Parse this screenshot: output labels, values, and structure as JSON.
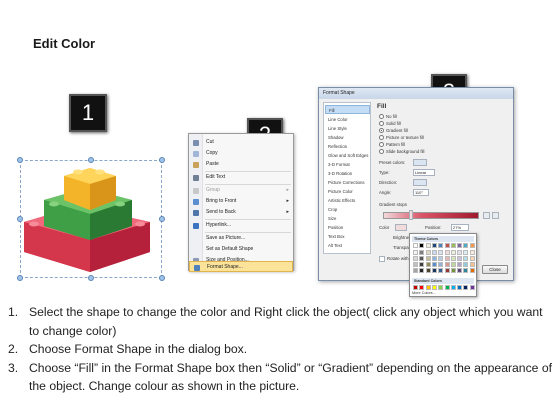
{
  "title": "Edit Color",
  "badges": [
    "1",
    "2",
    "3"
  ],
  "context_menu": {
    "items": [
      {
        "label": "Cut",
        "icon": "scissors-icon",
        "disabled": false,
        "submenu": false
      },
      {
        "label": "Copy",
        "icon": "copy-icon",
        "disabled": false,
        "submenu": false
      },
      {
        "label": "Paste",
        "icon": "paste-icon",
        "disabled": false,
        "submenu": false
      },
      {
        "label": "Edit Text",
        "icon": "edit-text-icon",
        "disabled": false,
        "submenu": false
      },
      {
        "label": "Group",
        "icon": "group-icon",
        "disabled": true,
        "submenu": true
      },
      {
        "label": "Bring to Front",
        "icon": "bring-front-icon",
        "disabled": false,
        "submenu": true
      },
      {
        "label": "Send to Back",
        "icon": "send-back-icon",
        "disabled": false,
        "submenu": true
      },
      {
        "label": "Hyperlink...",
        "icon": "hyperlink-icon",
        "disabled": false,
        "submenu": false
      },
      {
        "label": "Save as Picture...",
        "icon": "",
        "disabled": false,
        "submenu": false
      },
      {
        "label": "Set as Default Shape",
        "icon": "",
        "disabled": false,
        "submenu": false
      },
      {
        "label": "Size and Position...",
        "icon": "size-position-icon",
        "disabled": false,
        "submenu": false
      },
      {
        "label": "Format Shape...",
        "icon": "format-shape-icon",
        "disabled": false,
        "submenu": false,
        "highlighted": true
      }
    ]
  },
  "dialog": {
    "title": "Format Shape",
    "categories": [
      "Fill",
      "Line Color",
      "Line Style",
      "Shadow",
      "Reflection",
      "Glow and Soft Edges",
      "3-D Format",
      "3-D Rotation",
      "Picture Corrections",
      "Picture Color",
      "Artistic Effects",
      "Crop",
      "Size",
      "Position",
      "Text Box",
      "Alt Text"
    ],
    "selected_category": "Fill",
    "pane_heading": "Fill",
    "fill_options": [
      {
        "label": "No fill",
        "checked": false
      },
      {
        "label": "Solid fill",
        "checked": false
      },
      {
        "label": "Gradient fill",
        "checked": true
      },
      {
        "label": "Picture or texture fill",
        "checked": false
      },
      {
        "label": "Pattern fill",
        "checked": false
      },
      {
        "label": "Slide background fill",
        "checked": false
      }
    ],
    "fields": {
      "preset_colors": "Preset colors:",
      "type_label": "Type:",
      "type_value": "Linear",
      "direction_label": "Direction:",
      "angle_label": "Angle:",
      "angle_value": "110°",
      "gradient_stops": "Gradient stops",
      "color_label": "Color",
      "position_label": "Position:",
      "position_value": "27%",
      "brightness_label": "Brightness:",
      "transparency_label": "Transparency:",
      "rotate_label": "Rotate with shape"
    },
    "close_label": "Close",
    "palette": {
      "theme_heading": "Theme Colors",
      "standard_heading": "Standard Colors",
      "more_label": "More Colors...",
      "theme_top": [
        "#ffffff",
        "#000000",
        "#eeece1",
        "#1f497d",
        "#4f81bd",
        "#c0504d",
        "#9bbb59",
        "#8064a2",
        "#4bacc6",
        "#f79646"
      ],
      "theme_shades": [
        [
          "#f2f2f2",
          "#7f7f7f",
          "#ddd9c3",
          "#c6d9f0",
          "#dbe5f1",
          "#f2dcdb",
          "#ebf1dd",
          "#e5e0ec",
          "#dbeef3",
          "#fdeada"
        ],
        [
          "#d8d8d8",
          "#595959",
          "#c4bd97",
          "#8db3e2",
          "#b8cce4",
          "#e5b9b7",
          "#d7e3bc",
          "#ccc1d9",
          "#b7dde8",
          "#fbd5b5"
        ],
        [
          "#bfbfbf",
          "#3f3f3f",
          "#938953",
          "#548dd4",
          "#95b3d7",
          "#d99694",
          "#c3d69b",
          "#b2a2c7",
          "#92cddc",
          "#fac08f"
        ],
        [
          "#a5a5a5",
          "#262626",
          "#494429",
          "#17365d",
          "#366092",
          "#953734",
          "#76923c",
          "#5f497a",
          "#31859b",
          "#e36c09"
        ]
      ],
      "standard": [
        "#c00000",
        "#ff0000",
        "#ffc000",
        "#ffff00",
        "#92d050",
        "#00b050",
        "#00b0f0",
        "#0070c0",
        "#002060",
        "#7030a0"
      ]
    }
  },
  "steps": [
    {
      "num": "1.",
      "text": "Select the shape to change the color and Right click the object( click any object which you want to change color)"
    },
    {
      "num": "2.",
      "text": "Choose Format Shape in the dialog box."
    },
    {
      "num": "3.",
      "text": "Choose “Fill” in the Format Shape box then “Solid” or “Gradient” depending on the appearance of the object. Change colour as shown in the picture."
    }
  ]
}
